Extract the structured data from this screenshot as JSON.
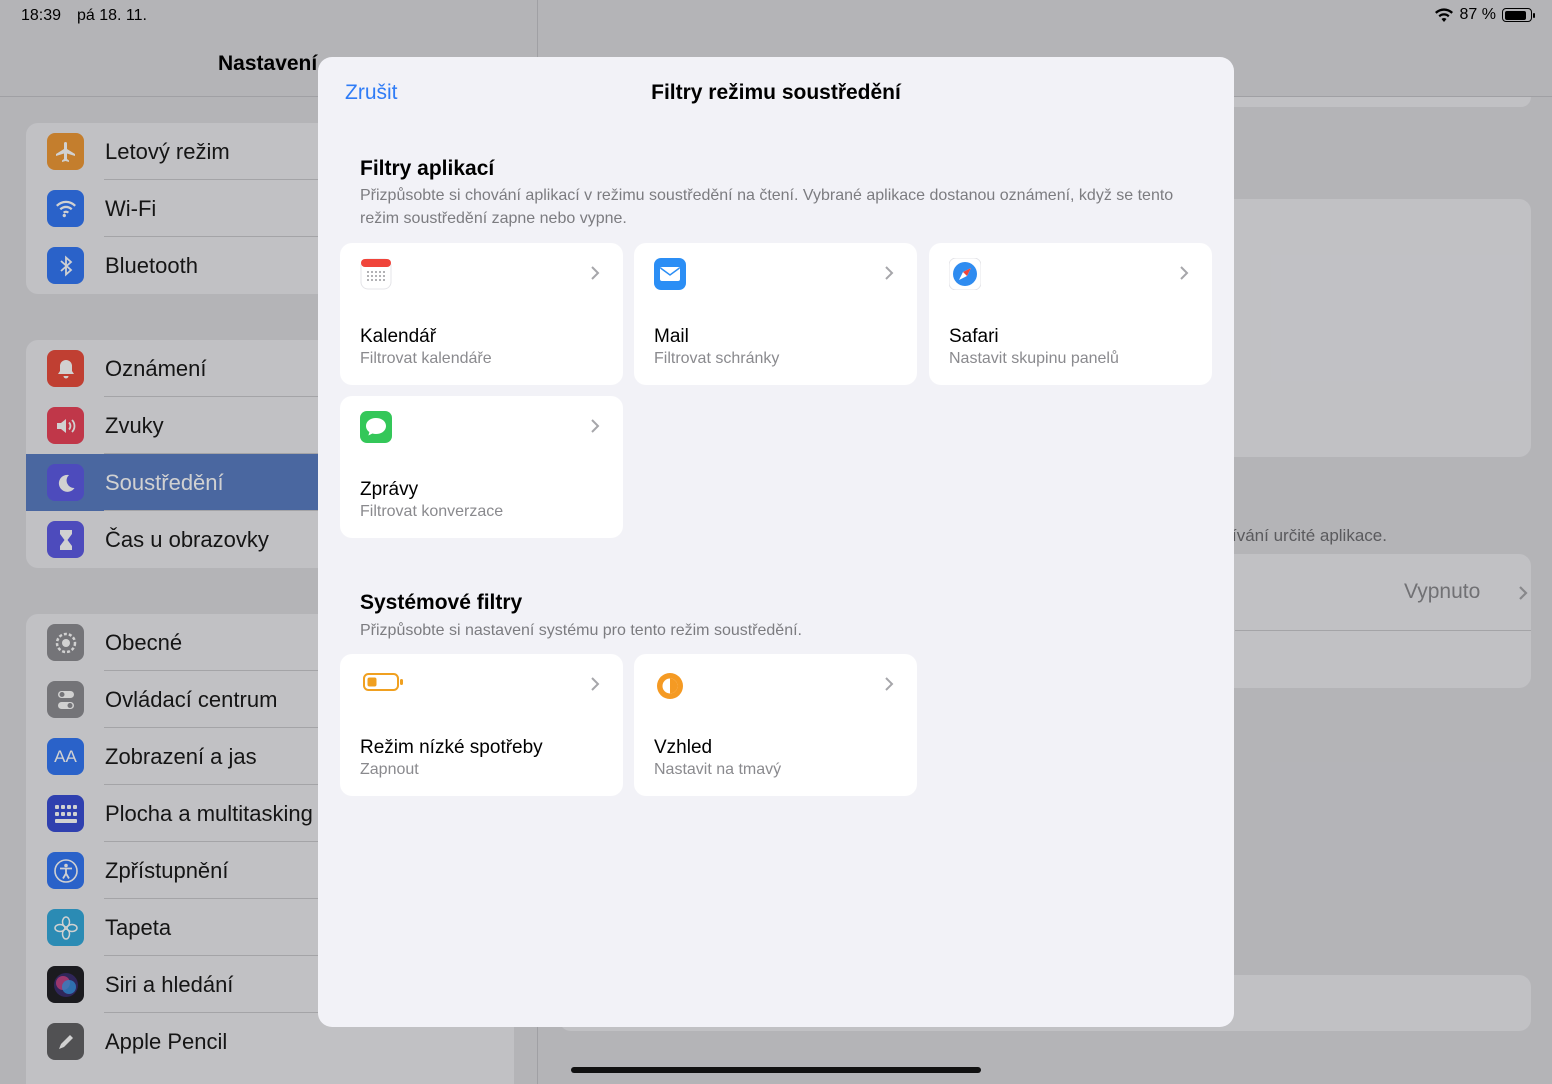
{
  "status_bar": {
    "time": "18:39",
    "date": "pá 18. 11.",
    "battery_text": "87 %",
    "battery_level": 0.87
  },
  "sidebar": {
    "title": "Nastavení",
    "groups": [
      [
        {
          "label": "Letový režim",
          "icon": "airplane-icon",
          "color": "#f09a37"
        },
        {
          "label": "Wi-Fi",
          "icon": "wifi-icon",
          "color": "#3478f6"
        },
        {
          "label": "Bluetooth",
          "icon": "bluetooth-icon",
          "color": "#3478f6"
        }
      ],
      [
        {
          "label": "Oznámení",
          "icon": "bell-icon",
          "color": "#eb4e3d"
        },
        {
          "label": "Zvuky",
          "icon": "speaker-icon",
          "color": "#eb445a"
        },
        {
          "label": "Soustředění",
          "icon": "moon-icon",
          "color": "#5e5ce6",
          "selected": true
        },
        {
          "label": "Čas u obrazovky",
          "icon": "hourglass-icon",
          "color": "#5e5ce6"
        }
      ],
      [
        {
          "label": "Obecné",
          "icon": "gear-icon",
          "color": "#8e8e93"
        },
        {
          "label": "Ovládací centrum",
          "icon": "toggles-icon",
          "color": "#8e8e93"
        },
        {
          "label": "Zobrazení a jas",
          "icon": "text-size-icon",
          "color": "#3478f6"
        },
        {
          "label": "Plocha a multitasking",
          "icon": "grid-icon",
          "color": "#3a4fd6"
        },
        {
          "label": "Zpřístupnění",
          "icon": "accessibility-icon",
          "color": "#3478f6"
        },
        {
          "label": "Tapeta",
          "icon": "flower-icon",
          "color": "#35aadc"
        },
        {
          "label": "Siri a hledání",
          "icon": "siri-icon",
          "color": "#222226"
        },
        {
          "label": "Apple Pencil",
          "icon": "pencil-icon",
          "color": "#636366"
        }
      ]
    ]
  },
  "detail": {
    "hint_text": "ívání určité aplikace.",
    "value_text": "Vypnuto"
  },
  "modal": {
    "cancel_label": "Zrušit",
    "title": "Filtry režimu soustředění",
    "app_filters": {
      "title": "Filtry aplikací",
      "description": "Přizpůsobte si chování aplikací v režimu soustředění na čtení. Vybrané aplikace dostanou oznámení, když se tento režim soustředění zapne nebo vypne.",
      "cards": [
        {
          "title": "Kalendář",
          "subtitle": "Filtrovat kalendáře",
          "icon": "calendar-icon"
        },
        {
          "title": "Mail",
          "subtitle": "Filtrovat schránky",
          "icon": "mail-icon"
        },
        {
          "title": "Safari",
          "subtitle": "Nastavit skupinu panelů",
          "icon": "safari-icon"
        },
        {
          "title": "Zprávy",
          "subtitle": "Filtrovat konverzace",
          "icon": "messages-icon"
        }
      ]
    },
    "system_filters": {
      "title": "Systémové filtry",
      "description": "Přizpůsobte si nastavení systému pro tento režim soustředění.",
      "cards": [
        {
          "title": "Režim nízké spotřeby",
          "subtitle": "Zapnout",
          "icon": "low-battery-icon"
        },
        {
          "title": "Vzhled",
          "subtitle": "Nastavit na tmavý",
          "icon": "appearance-icon"
        }
      ]
    }
  }
}
